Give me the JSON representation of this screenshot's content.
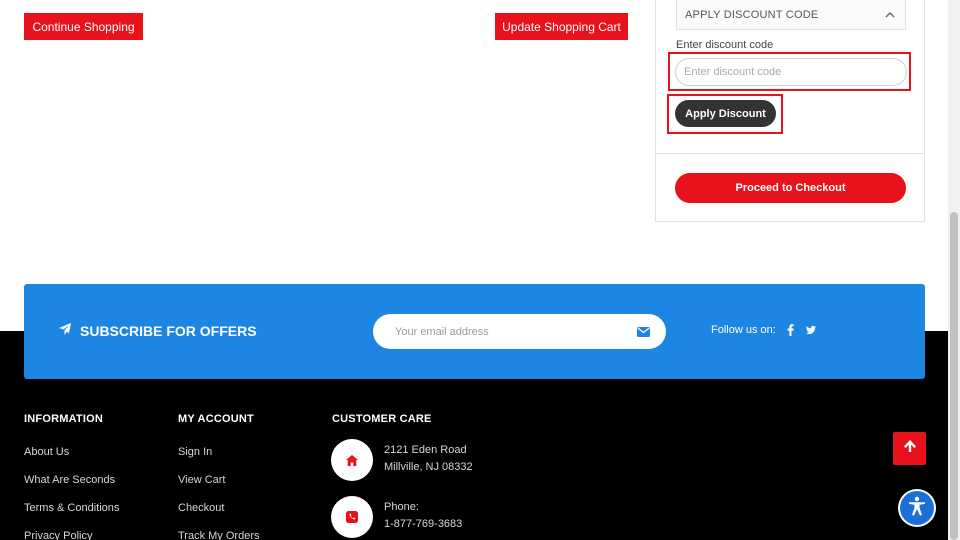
{
  "cart_actions": {
    "continue_label": "Continue Shopping",
    "update_label": "Update Shopping Cart"
  },
  "summary": {
    "discount_header": "APPLY DISCOUNT CODE",
    "discount_label": "Enter discount code",
    "discount_placeholder": "Enter discount code",
    "apply_label": "Apply Discount",
    "checkout_label": "Proceed to Checkout"
  },
  "subscribe": {
    "title": "SUBSCRIBE FOR OFFERS",
    "email_placeholder": "Your email address",
    "follow_label": "Follow us on:"
  },
  "footer": {
    "information": {
      "title": "INFORMATION",
      "links": [
        "About Us",
        "What Are Seconds",
        "Terms & Conditions",
        "Privacy Policy"
      ]
    },
    "my_account": {
      "title": "MY ACCOUNT",
      "links": [
        "Sign In",
        "View Cart",
        "Checkout",
        "Track My Orders"
      ]
    },
    "customer_care": {
      "title": "CUSTOMER CARE",
      "address_line1": "2121 Eden Road",
      "address_line2": "Millville, NJ 08332",
      "phone_label": "Phone:",
      "phone_number": "1-877-769-3683"
    }
  },
  "colors": {
    "brand_red": "#e8121c",
    "subscribe_blue": "#1d86e3",
    "footer_black": "#000000",
    "dark_button": "#333333"
  }
}
